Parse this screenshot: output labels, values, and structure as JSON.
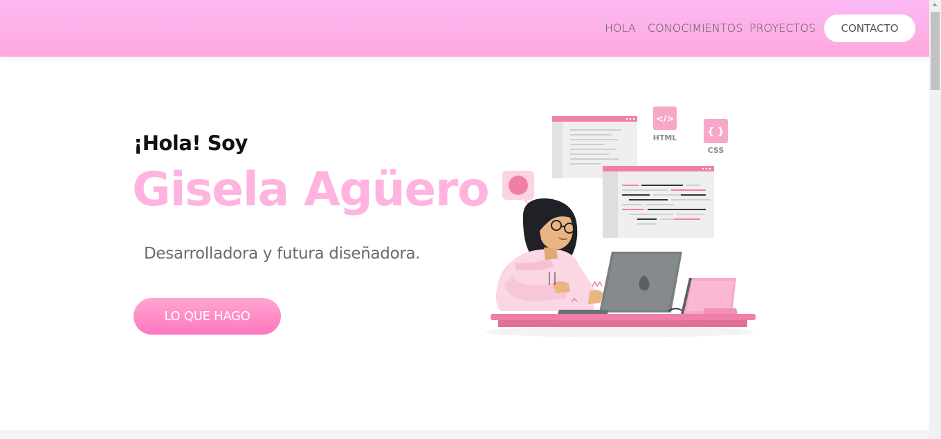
{
  "nav": {
    "items": [
      {
        "label": "HOLA"
      },
      {
        "label": "CONOCIMIENTOS"
      },
      {
        "label": "PROYECTOS"
      }
    ],
    "contact_label": "CONTACTO"
  },
  "hero": {
    "greeting": "¡Hola! Soy",
    "name": "Gisela Agüero",
    "subtitle": "Desarrolladora y futura diseñadora.",
    "button_label": "LO QUE HAGO"
  },
  "illustration": {
    "html_tag": "</>",
    "html_label": "HTML",
    "css_tag": "{ }",
    "css_label": "CSS"
  },
  "colors": {
    "nav_gradient_top": "#fbb8f4",
    "nav_gradient_bottom": "#ffa9dc",
    "name_pink": "#ffb4e0",
    "button_pink": "#ff77c0",
    "accent_pink": "#f07fa8"
  }
}
